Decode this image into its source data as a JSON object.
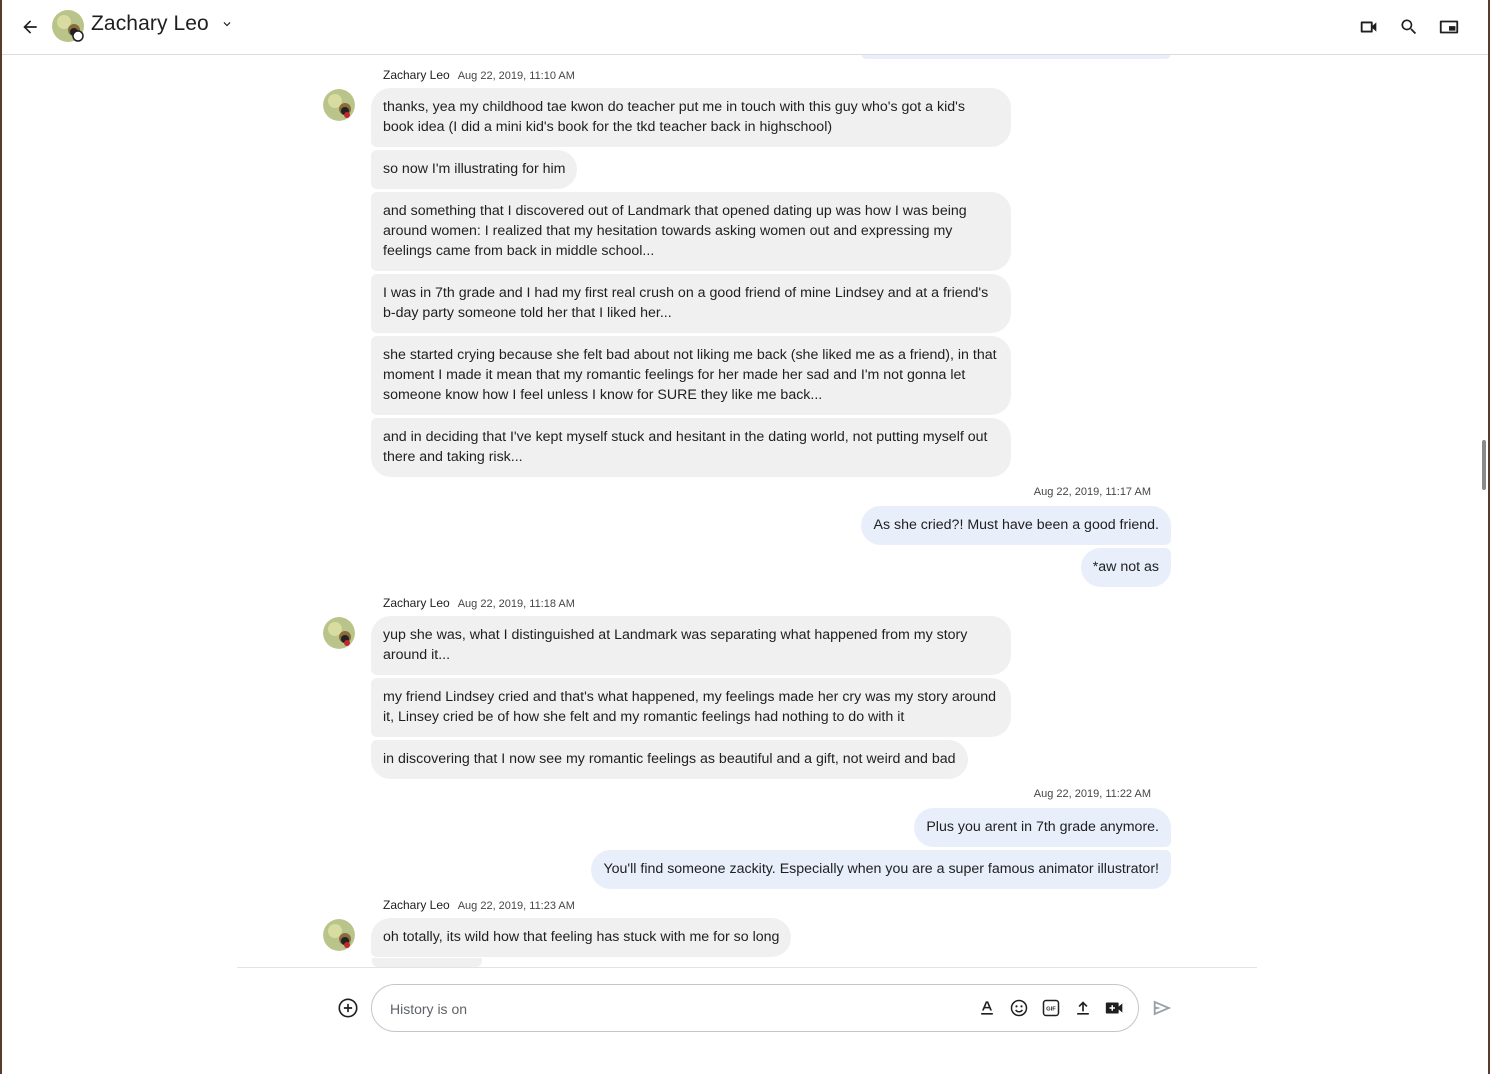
{
  "header": {
    "contact_name": "Zachary Leo"
  },
  "icons": {
    "back": "arrow-back-icon",
    "chevron": "chevron-down-icon",
    "video": "video-call-icon",
    "search": "search-icon",
    "pip": "picture-in-picture-icon",
    "add": "add-circle-icon",
    "format": "text-format-icon",
    "emoji": "emoji-icon",
    "gif": "gif-icon",
    "upload": "upload-icon",
    "meet": "video-meeting-icon",
    "send": "send-icon"
  },
  "colors": {
    "incoming_bubble": "#f0f0f0",
    "outgoing_bubble": "#e8eefa",
    "divider": "#dadce0"
  },
  "groups": [
    {
      "sender": "Zachary Leo",
      "time": "Aug 22, 2019, 11:10 AM",
      "messages": [
        "thanks, yea my childhood tae kwon do teacher put me in touch with this guy who's got a kid's book idea (I did a mini kid's book for the tkd teacher back in highschool)",
        "so now I'm illustrating for him",
        "and something that I discovered out of Landmark that opened dating up was how I was being around women: I realized that my hesitation towards asking women out and expressing my feelings came from back in middle school...",
        "I was in 7th grade and I had my first real crush on a good friend of mine Lindsey and at a friend's b-day party someone told her that I liked her...",
        "she started crying because she felt bad about not liking me back (she liked me as a friend), in that moment I made it mean that my romantic feelings for her made her sad and I'm not gonna let someone know how I feel unless I know for SURE they like me back...",
        "and in deciding that I've kept myself stuck and hesitant in the dating world, not putting myself out there and taking risk..."
      ]
    },
    {
      "sender": "",
      "time": "Aug 22, 2019, 11:17 AM",
      "messages": [
        "As she cried?! Must have been a good friend.",
        "*aw not as"
      ]
    },
    {
      "sender": "Zachary Leo",
      "time": "Aug 22, 2019, 11:18 AM",
      "messages": [
        "yup she was, what I distinguished at Landmark was separating what happened from my story around it...",
        "my friend Lindsey cried and that's what happened, my feelings made her cry was my story around it, Linsey cried be of how she felt and my romantic feelings had nothing to do with it",
        "in discovering that I now see my romantic feelings as beautiful and a gift, not weird and bad"
      ]
    },
    {
      "sender": "",
      "time": "Aug 22, 2019, 11:22 AM",
      "messages": [
        "Plus you arent in 7th grade anymore.",
        "You'll find someone zackity. Especially when you are a super famous animator illustrator!"
      ]
    },
    {
      "sender": "Zachary Leo",
      "time": "Aug 22, 2019, 11:23 AM",
      "messages": [
        "oh totally, its wild how that feeling has stuck with me for so long"
      ]
    }
  ],
  "composer": {
    "placeholder": "History is on"
  }
}
